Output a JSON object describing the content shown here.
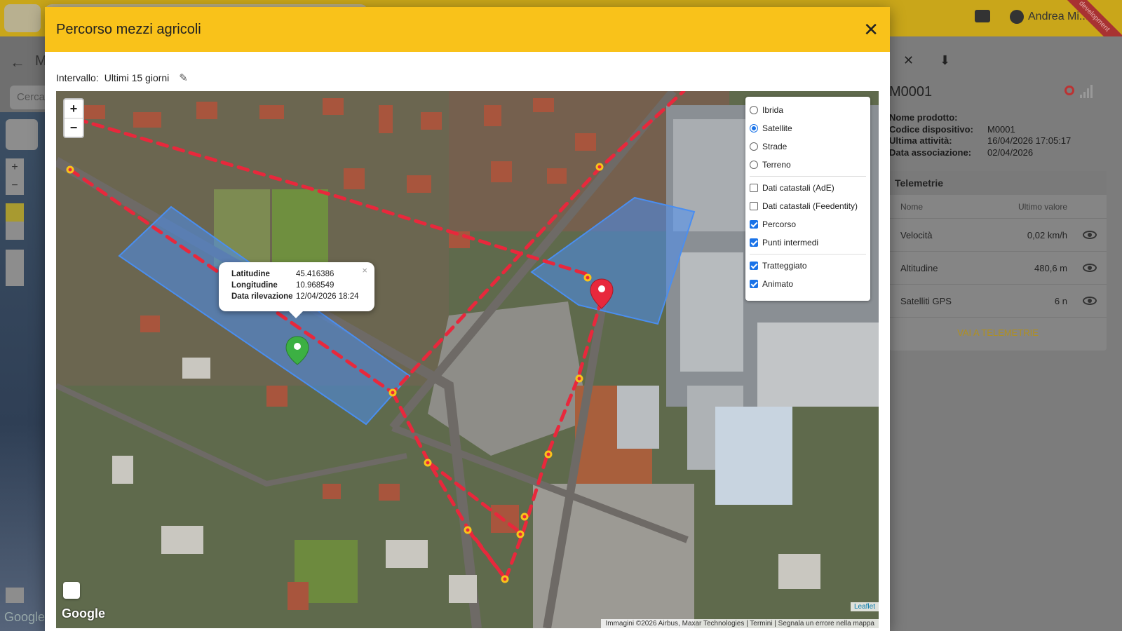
{
  "app": {
    "user_name": "Andrea Mi...ili",
    "ribbon": "development",
    "back_label": "M",
    "search_placeholder": "Cerca",
    "google_label": "Google"
  },
  "modal": {
    "title": "Percorso mezzi agricoli",
    "interval_label": "Intervallo:",
    "interval_value": "Ultimi 15 giorni"
  },
  "map": {
    "zoom_in": "+",
    "zoom_out": "−",
    "layers": {
      "base": [
        {
          "label": "Ibrida",
          "selected": false
        },
        {
          "label": "Satellite",
          "selected": true
        },
        {
          "label": "Strade",
          "selected": false
        },
        {
          "label": "Terreno",
          "selected": false
        }
      ],
      "overlays": [
        {
          "label": "Dati catastali (AdE)",
          "checked": false
        },
        {
          "label": "Dati catastali (Feedentity)",
          "checked": false
        },
        {
          "label": "Percorso",
          "checked": true
        },
        {
          "label": "Punti intermedi",
          "checked": true
        }
      ],
      "options": [
        {
          "label": "Tratteggiato",
          "checked": true
        },
        {
          "label": "Animato",
          "checked": true
        }
      ]
    },
    "popup": {
      "lat_label": "Latitudine",
      "lat_value": "45.416386",
      "lon_label": "Longitudine",
      "lon_value": "10.968549",
      "date_label": "Data rilevazione",
      "date_value": "12/04/2026 18:24",
      "close": "×"
    },
    "google_logo": "Google",
    "leaflet": "Leaflet",
    "attribution": "Immagini ©2026 Airbus, Maxar Technologies | Termini | Segnala un errore nella mappa",
    "colors": {
      "route": "#e8283c",
      "area": "#4a8ef0"
    }
  },
  "device": {
    "title": "M0001",
    "info": [
      {
        "k": "Nome prodotto:",
        "v": ""
      },
      {
        "k": "Codice dispositivo:",
        "v": "M0001"
      },
      {
        "k": "Ultima attività:",
        "v": "16/04/2026 17:05:17"
      },
      {
        "k": "Data associazione:",
        "v": "02/04/2026"
      }
    ],
    "telemetry": {
      "title": "Telemetrie",
      "col_name": "Nome",
      "col_value": "Ultimo valore",
      "rows": [
        {
          "name": "Velocità",
          "value": "0,02 km/h"
        },
        {
          "name": "Altitudine",
          "value": "480,6 m"
        },
        {
          "name": "Satelliti GPS",
          "value": "6 n"
        }
      ],
      "link": "VAI A TELEMETRIE"
    }
  }
}
